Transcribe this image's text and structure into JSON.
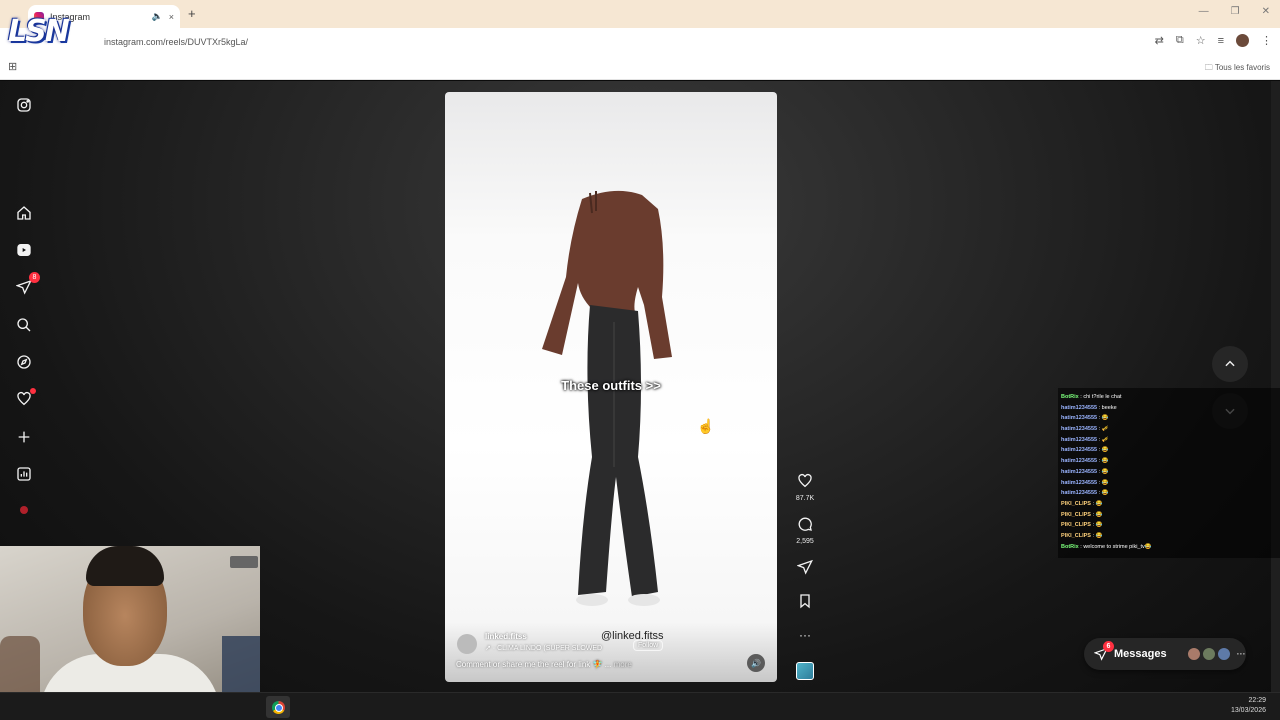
{
  "browser": {
    "tab_title": "Instagram",
    "tab_audio_icon": "speaker-icon",
    "tab_close": "×",
    "new_tab": "+",
    "url": "instagram.com/reels/DUVTXr5kgLa/",
    "bookmarks_label": "Tous les favoris",
    "window_controls": [
      "—",
      "❐",
      "✕"
    ]
  },
  "stream_logo": "LSN",
  "sidebar": {
    "items": [
      {
        "name": "instagram-logo-icon"
      },
      {
        "name": "home-icon"
      },
      {
        "name": "reels-icon"
      },
      {
        "name": "direct-icon",
        "badge": "8"
      },
      {
        "name": "search-icon"
      },
      {
        "name": "explore-icon"
      },
      {
        "name": "notifications-icon"
      },
      {
        "name": "create-icon"
      },
      {
        "name": "dashboard-icon"
      },
      {
        "name": "profile-icon"
      }
    ]
  },
  "reel": {
    "overlay_text": "These outfits >>",
    "username": "linked.fitss",
    "audio": "↗ · CLIMA LINDO (SUPER SLOWED",
    "follow_label": "Follow",
    "watermark": "@linked.fitss",
    "caption": "Comment or share me the reel for link 🧚 ...",
    "more_label": "more"
  },
  "actions": {
    "likes": "87.7K",
    "comments": "2,595"
  },
  "chat": [
    {
      "user": "BotRix",
      "text": " : chi t?rile le chat",
      "color": "#7cff7c"
    },
    {
      "user": "hatim1234555",
      "text": " : beeke",
      "color": "#9ab4ff"
    },
    {
      "user": "hatim1234555",
      "text": " : 😂",
      "color": "#9ab4ff"
    },
    {
      "user": "hatim1234555",
      "text": " : 🎺",
      "color": "#9ab4ff"
    },
    {
      "user": "hatim1234555",
      "text": " : 🎺",
      "color": "#9ab4ff"
    },
    {
      "user": "hatim1234555",
      "text": " : 😂",
      "color": "#9ab4ff"
    },
    {
      "user": "hatim1234555",
      "text": " : 😂",
      "color": "#9ab4ff"
    },
    {
      "user": "hatim1234555",
      "text": " : 😂",
      "color": "#9ab4ff"
    },
    {
      "user": "hatim1234555",
      "text": " : 😂",
      "color": "#9ab4ff"
    },
    {
      "user": "hatim1234555",
      "text": " : 😂",
      "color": "#9ab4ff"
    },
    {
      "user": "PIKI_CLIPS",
      "text": " : 😂",
      "color": "#ffd27c"
    },
    {
      "user": "PIKI_CLIPS",
      "text": " : 😂",
      "color": "#ffd27c"
    },
    {
      "user": "PIKI_CLIPS",
      "text": " : 😂",
      "color": "#ffd27c"
    },
    {
      "user": "PIKI_CLIPS",
      "text": " : 😂",
      "color": "#ffd27c"
    },
    {
      "user": "BotRix",
      "text": " : welcome to strime piki_tv😂",
      "color": "#7cff7c"
    }
  ],
  "messages": {
    "label": "Messages",
    "badge": "6",
    "more": "···"
  },
  "taskbar": {
    "time": "22:29",
    "date": "13/03/2026"
  },
  "colors": {
    "badge_red": "#ff3040",
    "app_bg": "#161616",
    "tabstrip": "#f6e7d3"
  }
}
